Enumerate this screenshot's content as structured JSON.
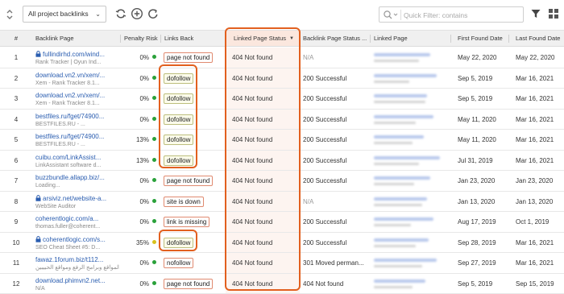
{
  "toolbar": {
    "view_select": "All project backlinks",
    "search_placeholder": "Quick Filter: contains",
    "icons": [
      "sort-toggle-icon",
      "refresh-icon",
      "add-icon",
      "reload-icon",
      "search-icon",
      "filter-icon",
      "columns-icon"
    ]
  },
  "columns": {
    "num": "#",
    "backlink_page": "Backlink Page",
    "penalty_risk": "Penalty Risk",
    "links_back": "Links Back",
    "linked_page_status": "Linked Page Status",
    "backlink_page_status": "Backlink Page Status ...",
    "linked_page": "Linked Page",
    "first_found": "First Found Date",
    "last_found": "Last Found Date"
  },
  "colors": {
    "accent": "#e2601f",
    "link": "#2a5db0",
    "risk_green": "#2aa13a",
    "risk_yellow": "#d8c21c",
    "sorted_header": "#fbe7de"
  },
  "rows": [
    {
      "num": "1",
      "secure": true,
      "url": "fullindirhd.com/wind...",
      "title": "Rank Tracker | Oyun İnd...",
      "risk": "0%",
      "risk_color": "green",
      "links_back": "page not found",
      "links_ok": false,
      "status": "404 Not found",
      "bl_status": "N/A",
      "first": "May 22, 2020",
      "last": "May 22, 2020"
    },
    {
      "num": "2",
      "secure": false,
      "url": "download.vn2.vn/xem/...",
      "title": "Xem - Rank Tracker 8.1...",
      "risk": "0%",
      "risk_color": "green",
      "links_back": "dofollow",
      "links_ok": true,
      "status": "404 Not found",
      "bl_status": "200 Successful",
      "first": "Sep 5, 2019",
      "last": "Mar 16, 2021"
    },
    {
      "num": "3",
      "secure": false,
      "url": "download.vn2.vn/xem/...",
      "title": "Xem - Rank Tracker 8.1...",
      "risk": "0%",
      "risk_color": "green",
      "links_back": "dofollow",
      "links_ok": true,
      "status": "404 Not found",
      "bl_status": "200 Successful",
      "first": "Sep 5, 2019",
      "last": "Mar 16, 2021"
    },
    {
      "num": "4",
      "secure": false,
      "url": "bestfiles.ru/fget/74900...",
      "title": "BESTFILES.RU - ...",
      "risk": "0%",
      "risk_color": "green",
      "links_back": "dofollow",
      "links_ok": true,
      "status": "404 Not found",
      "bl_status": "200 Successful",
      "first": "May 11, 2020",
      "last": "Mar 16, 2021"
    },
    {
      "num": "5",
      "secure": false,
      "url": "bestfiles.ru/fget/74900...",
      "title": "BESTFILES.RU - ...",
      "risk": "13%",
      "risk_color": "green",
      "links_back": "dofollow",
      "links_ok": true,
      "status": "404 Not found",
      "bl_status": "200 Successful",
      "first": "May 11, 2020",
      "last": "Mar 16, 2021"
    },
    {
      "num": "6",
      "secure": false,
      "url": "cuibu.com/LinkAssist...",
      "title": "LinkAssistant software d...",
      "risk": "13%",
      "risk_color": "green",
      "links_back": "dofollow",
      "links_ok": true,
      "status": "404 Not found",
      "bl_status": "200 Successful",
      "first": "Jul 31, 2019",
      "last": "Mar 16, 2021"
    },
    {
      "num": "7",
      "secure": false,
      "url": "buzzbundle.allapp.biz/...",
      "title": "Loading...",
      "risk": "0%",
      "risk_color": "green",
      "links_back": "page not found",
      "links_ok": false,
      "status": "404 Not found",
      "bl_status": "200 Successful",
      "first": "Jan 23, 2020",
      "last": "Jan 23, 2020"
    },
    {
      "num": "8",
      "secure": true,
      "url": "arsiviz.net/website-a...",
      "title": "WebSite Auditor",
      "risk": "0%",
      "risk_color": "green",
      "links_back": "site is down",
      "links_ok": false,
      "status": "404 Not found",
      "bl_status": "N/A",
      "first": "Jan 13, 2020",
      "last": "Jan 13, 2020"
    },
    {
      "num": "9",
      "secure": false,
      "url": "coherentlogic.com/a...",
      "title": "thomas.fuller@coherent...",
      "risk": "0%",
      "risk_color": "green",
      "links_back": "link is missing",
      "links_ok": false,
      "status": "404 Not found",
      "bl_status": "200 Successful",
      "first": "Aug 17, 2019",
      "last": "Oct 1, 2019"
    },
    {
      "num": "10",
      "secure": true,
      "url": "coherentlogic.com/s...",
      "title": "SEO Cheat Sheet #5: D...",
      "risk": "35%",
      "risk_color": "yellow",
      "links_back": "dofollow",
      "links_ok": true,
      "status": "404 Not found",
      "bl_status": "200 Successful",
      "first": "Sep 28, 2019",
      "last": "Mar 16, 2021"
    },
    {
      "num": "11",
      "secure": false,
      "url": "fawaz.1forum.biz/t112...",
      "title": "التهم المواقع وبرامج الرفع ومواقع الحبيبين",
      "risk": "0%",
      "risk_color": "green",
      "links_back": "nofollow",
      "links_ok": false,
      "status": "404 Not found",
      "bl_status": "301 Moved perman...",
      "first": "Sep 27, 2019",
      "last": "Mar 16, 2021"
    },
    {
      "num": "12",
      "secure": false,
      "url": "download.phimvn2.net...",
      "title": "N/A",
      "risk": "0%",
      "risk_color": "green",
      "links_back": "page not found",
      "links_ok": false,
      "status": "404 Not found",
      "bl_status": "404 Not found",
      "first": "Sep 5, 2019",
      "last": "Sep 15, 2019"
    }
  ]
}
